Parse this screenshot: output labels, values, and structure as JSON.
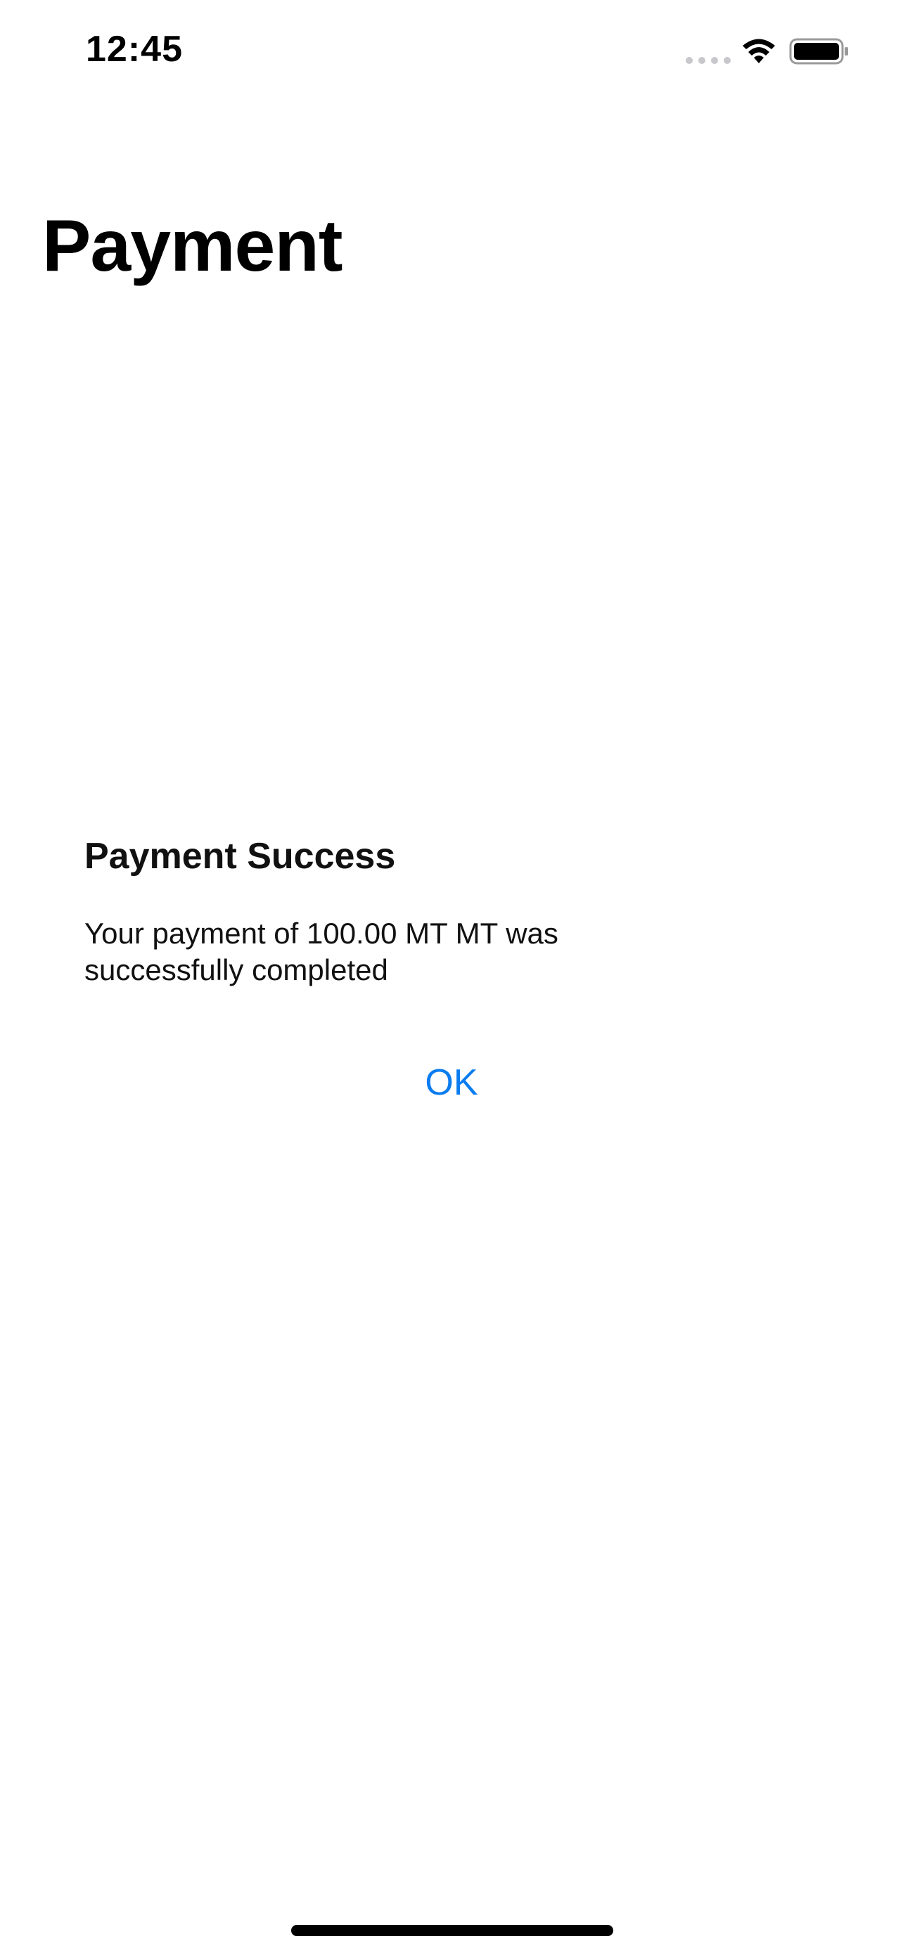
{
  "status_bar": {
    "time": "12:45",
    "icons": [
      "signal-dots-icon",
      "wifi-icon",
      "battery-icon"
    ]
  },
  "page": {
    "title": "Payment"
  },
  "alert": {
    "title": "Payment Success",
    "message": "Your payment of 100.00 MT MT was successfully completed",
    "ok_label": "OK",
    "accent_color": "#0a7cf0"
  }
}
